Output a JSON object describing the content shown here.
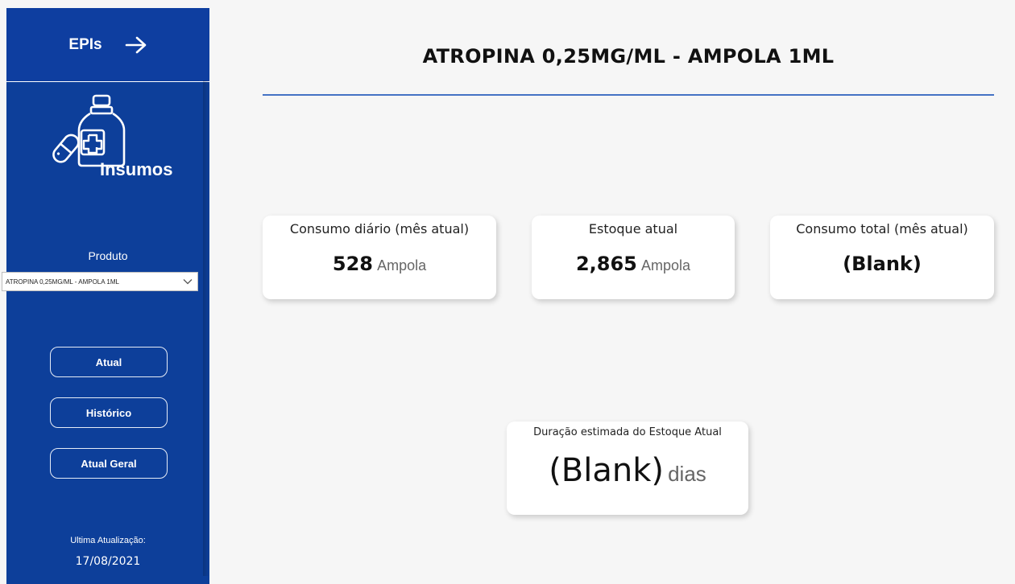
{
  "sidebar": {
    "header_label": "EPIs",
    "logo_text": "Insumos",
    "produto_label": "Produto",
    "produto_selected": "ATROPINA 0,25MG/ML - AMPOLA 1ML",
    "nav_buttons": [
      "Atual",
      "Histórico",
      "Atual Geral"
    ],
    "update_label": "Ultima Atualização:",
    "update_date": "17/08/2021"
  },
  "main": {
    "title": "ATROPINA 0,25MG/ML - AMPOLA 1ML",
    "cards": [
      {
        "label": "Consumo diário (mês atual)",
        "value": "528",
        "unit": "Ampola"
      },
      {
        "label": "Estoque atual",
        "value": "2,865",
        "unit": "Ampola"
      },
      {
        "label": "Consumo total (mês atual)",
        "value": "(Blank)",
        "unit": ""
      },
      {
        "label": "Duração estimada do Estoque Atual",
        "value": "(Blank)",
        "unit": "dias"
      }
    ]
  },
  "colors": {
    "sidebar": "#0d3f9a",
    "accent_rule": "#4472c4",
    "background": "#f6f6f6"
  }
}
